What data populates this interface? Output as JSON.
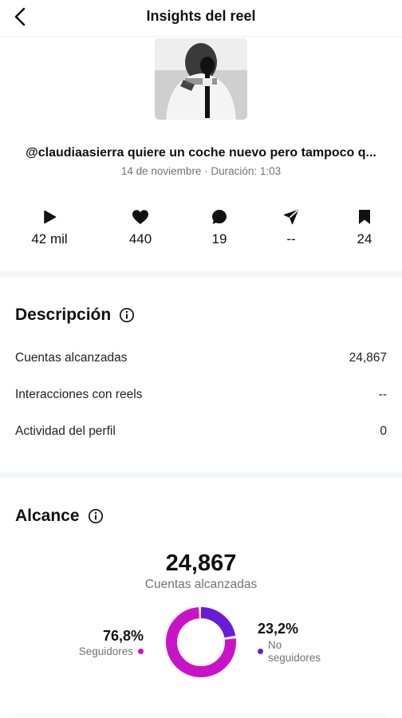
{
  "header": {
    "title": "Insights del reel"
  },
  "reel": {
    "title": "@claudiaasierra quiere un coche nuevo pero tampoco q...",
    "meta": "14 de noviembre · Duración: 1:03"
  },
  "stats": [
    {
      "icon": "play-icon",
      "value": "42 mil"
    },
    {
      "icon": "heart-icon",
      "value": "440"
    },
    {
      "icon": "comment-icon",
      "value": "19"
    },
    {
      "icon": "share-icon",
      "value": "--"
    },
    {
      "icon": "bookmark-icon",
      "value": "24"
    }
  ],
  "description": {
    "title": "Descripción",
    "rows": [
      {
        "label": "Cuentas alcanzadas",
        "value": "24,867"
      },
      {
        "label": "Interacciones con reels",
        "value": "--"
      },
      {
        "label": "Actividad del perfil",
        "value": "0"
      }
    ]
  },
  "reach": {
    "title": "Alcance",
    "total": "24,867",
    "total_label": "Cuentas alcanzadas",
    "followers_pct": "76,8%",
    "followers_label": "Seguidores",
    "followers_fraction": 0.768,
    "non_followers_pct": "23,2%",
    "non_followers_label": "No seguidores",
    "non_followers_fraction": 0.232
  },
  "colors": {
    "followers": "#c913c9",
    "non_followers": "#6a1bd6",
    "text_secondary": "#737373"
  }
}
